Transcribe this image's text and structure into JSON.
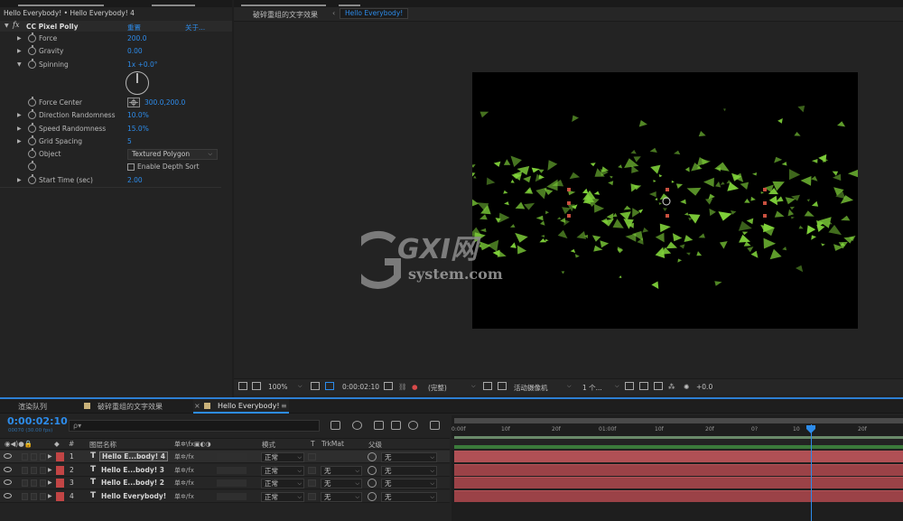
{
  "effects_panel": {
    "header": "Hello Everybody! • Hello Everybody! 4",
    "effect_name": "CC Pixel Polly",
    "reset_label": "重置",
    "about_label": "关于...",
    "properties": [
      {
        "label": "Force",
        "value": "200.0"
      },
      {
        "label": "Gravity",
        "value": "0.00"
      },
      {
        "label": "Spinning",
        "value": "1x +0.0°"
      },
      {
        "label": "Force Center",
        "value": "300.0,200.0"
      },
      {
        "label": "Direction Randomness",
        "value": "10.0%"
      },
      {
        "label": "Speed Randomness",
        "value": "15.0%"
      },
      {
        "label": "Grid Spacing",
        "value": "5"
      },
      {
        "label": "Object",
        "value": "Textured Polygon"
      },
      {
        "label": "",
        "value": "Enable Depth Sort"
      },
      {
        "label": "Start Time (sec)",
        "value": "2.00"
      }
    ]
  },
  "viewer": {
    "breadcrumb_1": "破碎重组的文字效果",
    "breadcrumb_2": "Hello Everybody!",
    "watermark_main": "GXI网",
    "watermark_sub": "system.com",
    "toolbar": {
      "zoom": "100%",
      "timecode": "0:00:02:10",
      "resolution": "(完整)",
      "camera": "活动摄像机",
      "views": "1 个...",
      "exposure": "+0.0"
    }
  },
  "timeline": {
    "tabs": [
      "渲染队列",
      "破碎重组的文字效果",
      "Hello Everybody!"
    ],
    "close_glyph": "×",
    "menu_glyph": "≡",
    "current_time": "0:00:02:10",
    "frame_info": "00070 (30.00 fps)",
    "search_glyph": "ρ▾",
    "columns": {
      "hash": "#",
      "layer_name": "图层名称",
      "mode": "模式",
      "t": "T",
      "trkmat": "TrkMat",
      "parent": "父级"
    },
    "switch_glyphs": "单✲\\fx▣◐◑",
    "layers": [
      {
        "num": "1",
        "name": "Hello E...body! 4",
        "mode": "正常",
        "trkmat": "",
        "parent": "无",
        "selected": true
      },
      {
        "num": "2",
        "name": "Hello E...body! 3",
        "mode": "正常",
        "trkmat": "无",
        "parent": "无",
        "selected": false
      },
      {
        "num": "3",
        "name": "Hello E...body! 2",
        "mode": "正常",
        "trkmat": "无",
        "parent": "无",
        "selected": false
      },
      {
        "num": "4",
        "name": "Hello Everybody!",
        "mode": "正常",
        "trkmat": "无",
        "parent": "无",
        "selected": false
      }
    ],
    "row_switches": "单✲/fx",
    "ruler_ticks": [
      "0:00f",
      "10f",
      "20f",
      "01:00f",
      "10f",
      "20f",
      "0?",
      "10",
      "20f"
    ]
  },
  "colors": {
    "accent": "#2d8ceb",
    "label_red": "#c24545",
    "track": "#9b4247",
    "particles": "#7fd13a"
  }
}
